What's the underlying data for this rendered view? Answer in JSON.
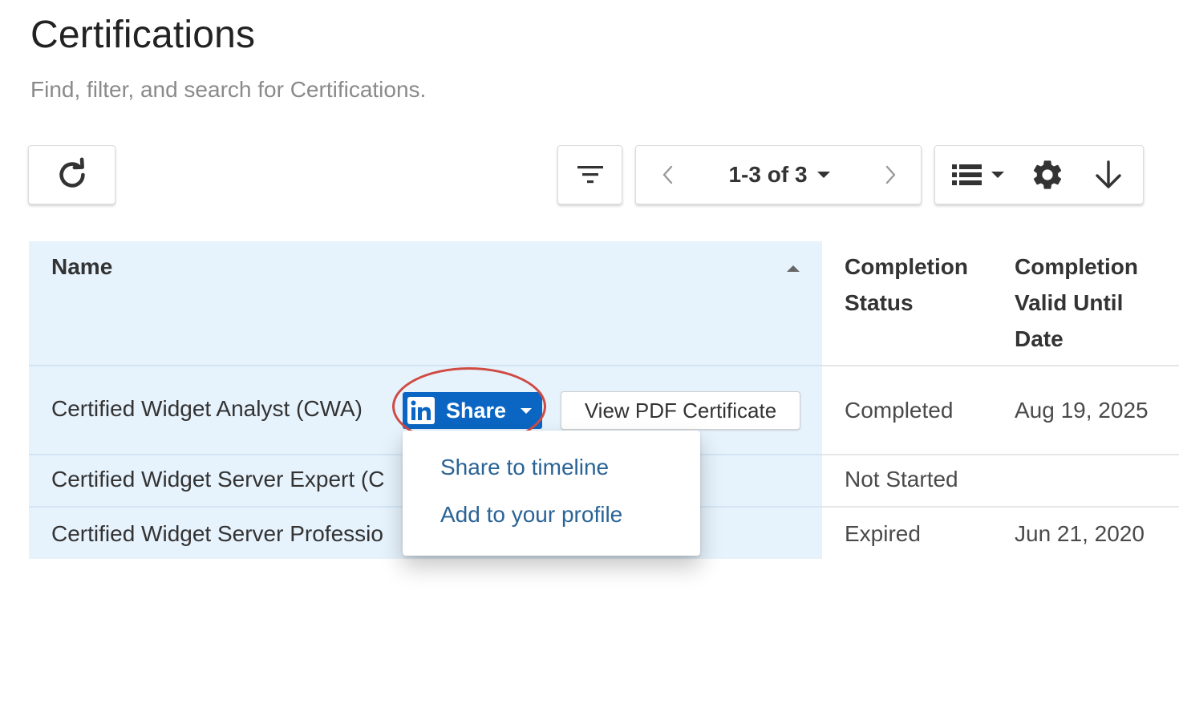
{
  "page": {
    "title": "Certifications",
    "subtitle": "Find, filter, and search for Certifications."
  },
  "toolbar": {
    "refresh_icon": "refresh-icon",
    "filter_icon": "filter-icon",
    "pagination": {
      "range": "1-3 of 3",
      "prev_icon": "chevron-left-icon",
      "next_icon": "chevron-right-icon"
    },
    "view_icon": "list-view-icon",
    "settings_icon": "gear-icon",
    "sort_icon": "arrow-down-icon"
  },
  "table": {
    "headers": {
      "name": "Name",
      "status_line1": "Completion",
      "status_line2": "Status",
      "valid_line1": "Completion",
      "valid_line2": "Valid Until",
      "valid_line3": "Date"
    },
    "rows": [
      {
        "name": "Certified Widget Analyst (CWA)",
        "status": "Completed",
        "valid_until": "Aug 19, 2025"
      },
      {
        "name": "Certified Widget Server Expert (C",
        "status": "Not Started",
        "valid_until": ""
      },
      {
        "name": "Certified Widget Server Professio",
        "status": "Expired",
        "valid_until": "Jun 21, 2020"
      }
    ]
  },
  "actions": {
    "share_label": "Share",
    "share_icon": "linkedin-icon",
    "view_pdf_label": "View PDF Certificate"
  },
  "share_menu": {
    "items": [
      "Share to timeline",
      "Add to your profile"
    ]
  },
  "colors": {
    "accent_linkedin": "#0a66c2",
    "row_highlight": "#e6f2fc",
    "menu_link": "#2a6496",
    "annotation_ring": "#cf4b43"
  }
}
